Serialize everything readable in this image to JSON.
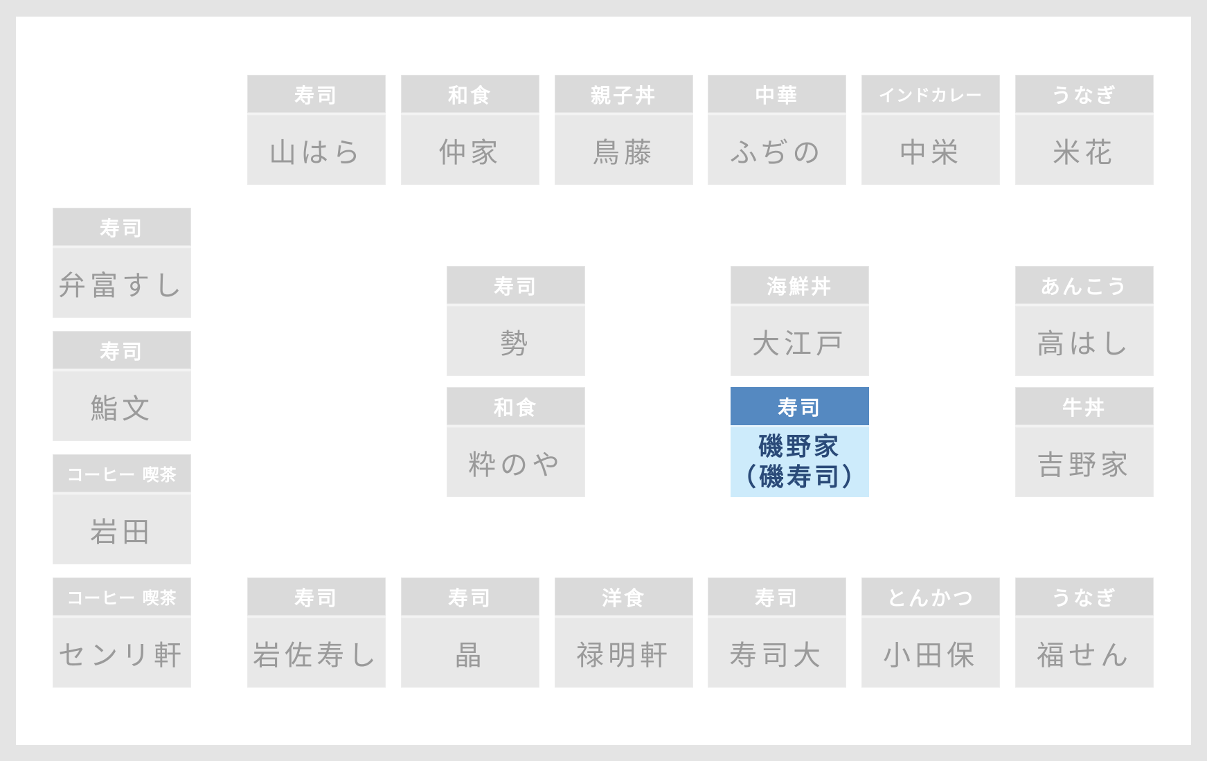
{
  "floor_map": {
    "selected_color": "#5589c1",
    "selected_body_color": "#cdebfb",
    "tile_header_color": "#dadada",
    "tile_body_color": "#e8e8e8",
    "top_row": [
      {
        "category": "寿司",
        "name": "山はら"
      },
      {
        "category": "和食",
        "name": "仲家"
      },
      {
        "category": "親子丼",
        "name": "鳥藤"
      },
      {
        "category": "中華",
        "name": "ふぢの"
      },
      {
        "category": "インドカレー",
        "name": "中栄"
      },
      {
        "category": "うなぎ",
        "name": "米花"
      }
    ],
    "left_column": [
      {
        "category": "寿司",
        "name": "弁富すし"
      },
      {
        "category": "寿司",
        "name": "鮨文"
      },
      {
        "category": "コーヒー 喫茶",
        "name": "岩田"
      },
      {
        "category": "コーヒー 喫茶",
        "name": "センリ軒"
      }
    ],
    "center_left": [
      {
        "category": "寿司",
        "name": "勢"
      },
      {
        "category": "和食",
        "name": "粋のや"
      }
    ],
    "center_right": [
      {
        "category": "海鮮丼",
        "name": "大江戸"
      },
      {
        "category": "寿司",
        "name": "磯野家（磯寿司）",
        "selected": true
      }
    ],
    "right_column": [
      {
        "category": "あんこう",
        "name": "高はし"
      },
      {
        "category": "牛丼",
        "name": "吉野家"
      }
    ],
    "bottom_row": [
      {
        "category": "寿司",
        "name": "岩佐寿し"
      },
      {
        "category": "寿司",
        "name": "晶"
      },
      {
        "category": "洋食",
        "name": "禄明軒"
      },
      {
        "category": "寿司",
        "name": "寿司大"
      },
      {
        "category": "とんかつ",
        "name": "小田保"
      },
      {
        "category": "うなぎ",
        "name": "福せん"
      }
    ]
  }
}
